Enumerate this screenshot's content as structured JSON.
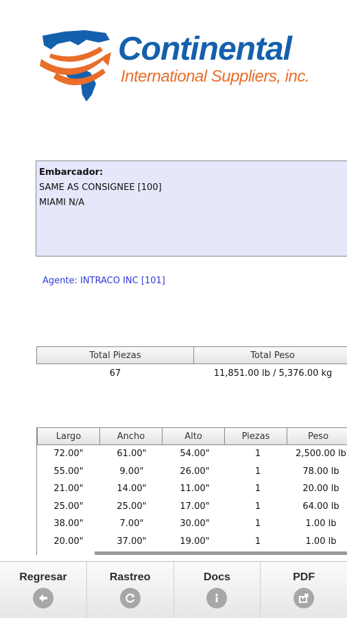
{
  "logo": {
    "title": "Continental",
    "subtitle": "International Suppliers, inc."
  },
  "shipper": {
    "label": "Embarcador:",
    "lines": [
      "SAME AS CONSIGNEE [100]",
      "MIAMI N/A"
    ]
  },
  "agent": "Agente: INTRACO INC [101]",
  "totals": {
    "headers": [
      "Total Piezas",
      "Total Peso"
    ],
    "values": [
      "67",
      "11,851.00 lb / 5,376.00 kg"
    ]
  },
  "dims": {
    "headers": [
      "Largo",
      "Ancho",
      "Alto",
      "Piezas",
      "Peso"
    ],
    "rows": [
      [
        "72.00\"",
        "61.00\"",
        "54.00\"",
        "1",
        "2,500.00 lb"
      ],
      [
        "55.00\"",
        "9.00\"",
        "26.00\"",
        "1",
        "78.00 lb"
      ],
      [
        "21.00\"",
        "14.00\"",
        "11.00\"",
        "1",
        "20.00 lb"
      ],
      [
        "25.00\"",
        "25.00\"",
        "17.00\"",
        "1",
        "64.00 lb"
      ],
      [
        "38.00\"",
        "7.00\"",
        "30.00\"",
        "1",
        "1.00 lb"
      ],
      [
        "20.00\"",
        "37.00\"",
        "19.00\"",
        "1",
        "1.00 lb"
      ]
    ]
  },
  "nav": [
    {
      "label": "Regresar",
      "icon": "arrow-left-icon"
    },
    {
      "label": "Rastreo",
      "icon": "refresh-icon"
    },
    {
      "label": "Docs",
      "icon": "info-icon"
    },
    {
      "label": "PDF",
      "icon": "share-icon"
    }
  ],
  "colors": {
    "brand_blue": "#1560ad",
    "brand_orange": "#e86e2a",
    "box_bg": "#e6e7fa",
    "agent_text": "#2b3bd6"
  }
}
